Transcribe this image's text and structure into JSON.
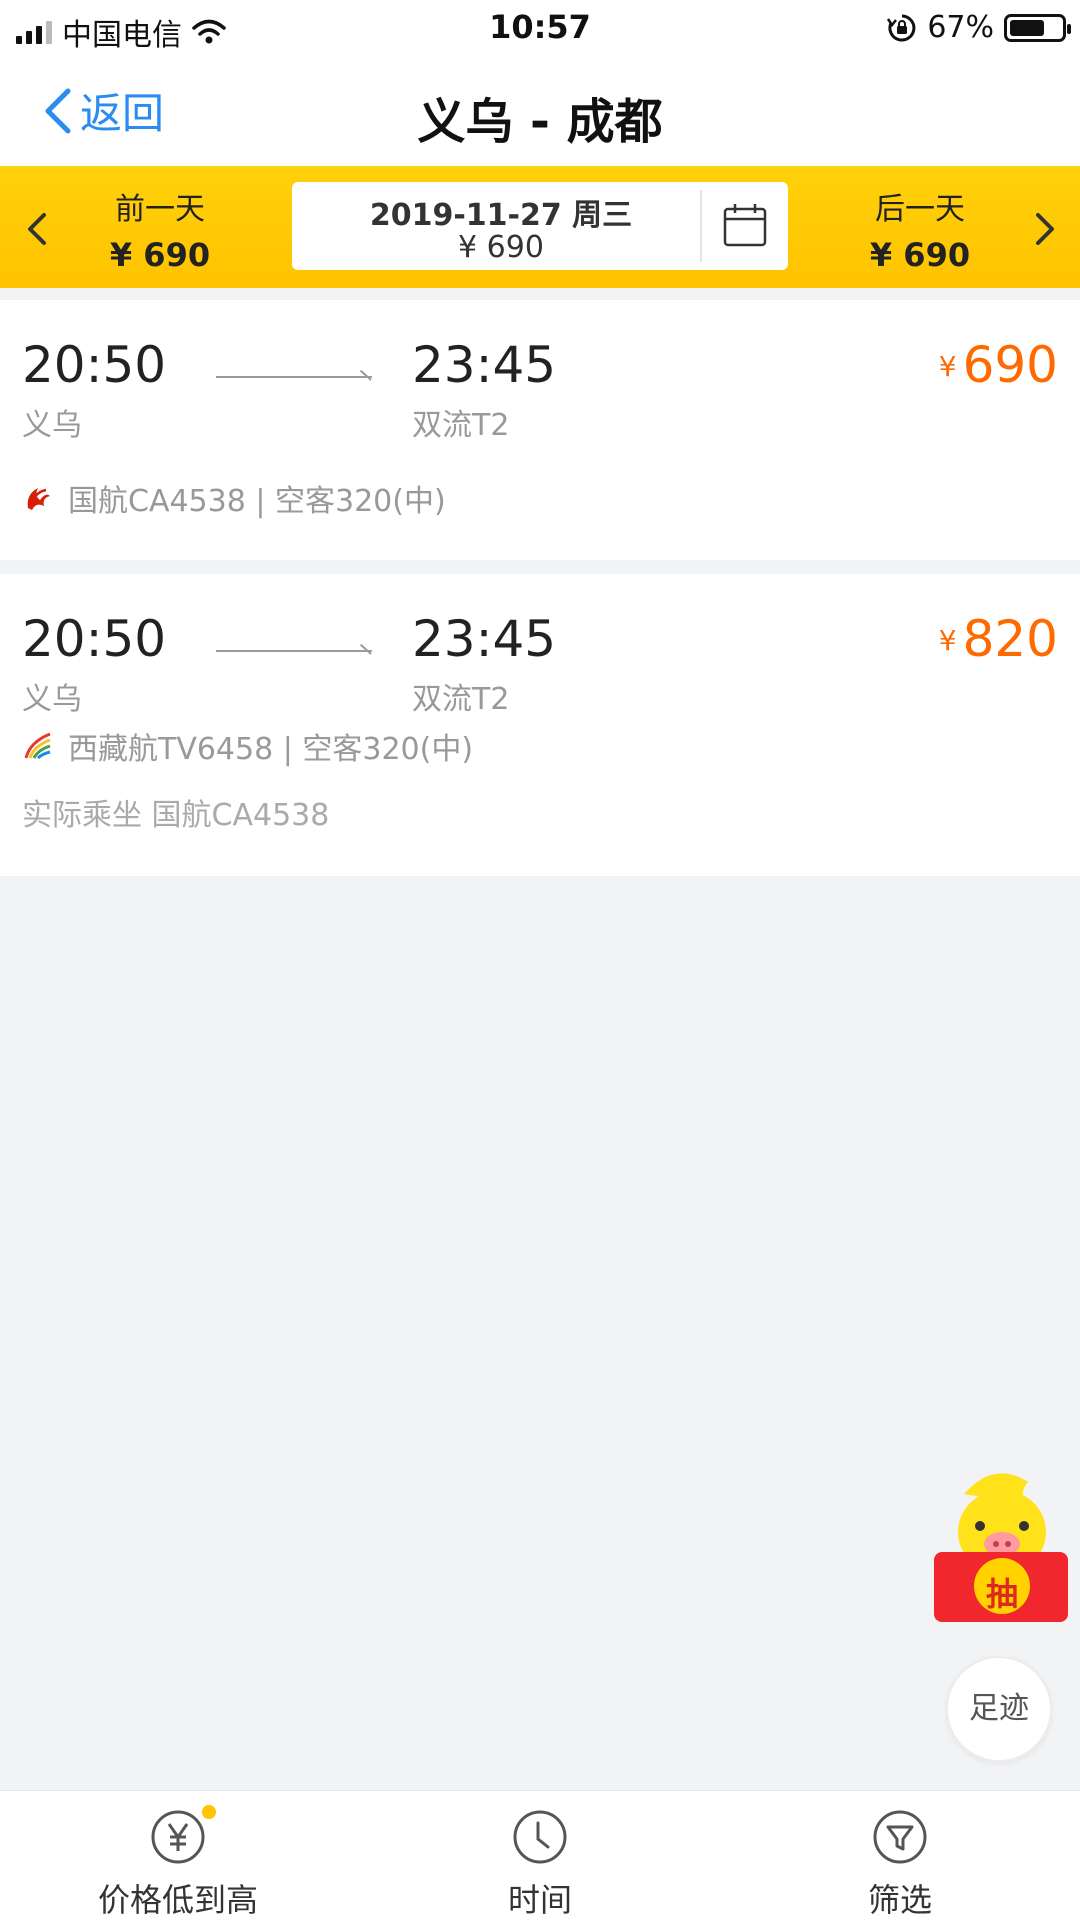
{
  "status_bar": {
    "carrier": "中国电信",
    "time": "10:57",
    "battery_percent": "67%",
    "battery_level": 0.67
  },
  "nav": {
    "back_label": "返回",
    "title": "义乌 - 成都"
  },
  "date_bar": {
    "prev_label": "前一天",
    "prev_price": "¥ 690",
    "current_date": "2019-11-27 周三",
    "current_price": "¥ 690",
    "next_label": "后一天",
    "next_price": "¥ 690"
  },
  "flights": [
    {
      "depart_time": "20:50",
      "arrive_time": "23:45",
      "depart_airport": "义乌",
      "arrive_airport": "双流T2",
      "currency": "¥",
      "price": "690",
      "airline_info": "国航CA4538 | 空客320(中)",
      "airline_icon": "air-china-logo",
      "actual_carrier": ""
    },
    {
      "depart_time": "20:50",
      "arrive_time": "23:45",
      "depart_airport": "义乌",
      "arrive_airport": "双流T2",
      "currency": "¥",
      "price": "820",
      "airline_info": "西藏航TV6458 | 空客320(中)",
      "airline_icon": "tibet-airlines-logo",
      "actual_carrier": "实际乘坐 国航CA4538"
    }
  ],
  "floating": {
    "lottery_char": "抽",
    "footprint_label": "足迹"
  },
  "bottom_tabs": [
    {
      "label": "价格低到高",
      "icon": "yen-icon"
    },
    {
      "label": "时间",
      "icon": "clock-icon"
    },
    {
      "label": "筛选",
      "icon": "filter-icon"
    }
  ],
  "colors": {
    "accent_yellow": "#ffc300",
    "price_orange": "#ff6a00",
    "link_blue": "#2a8cf0"
  }
}
